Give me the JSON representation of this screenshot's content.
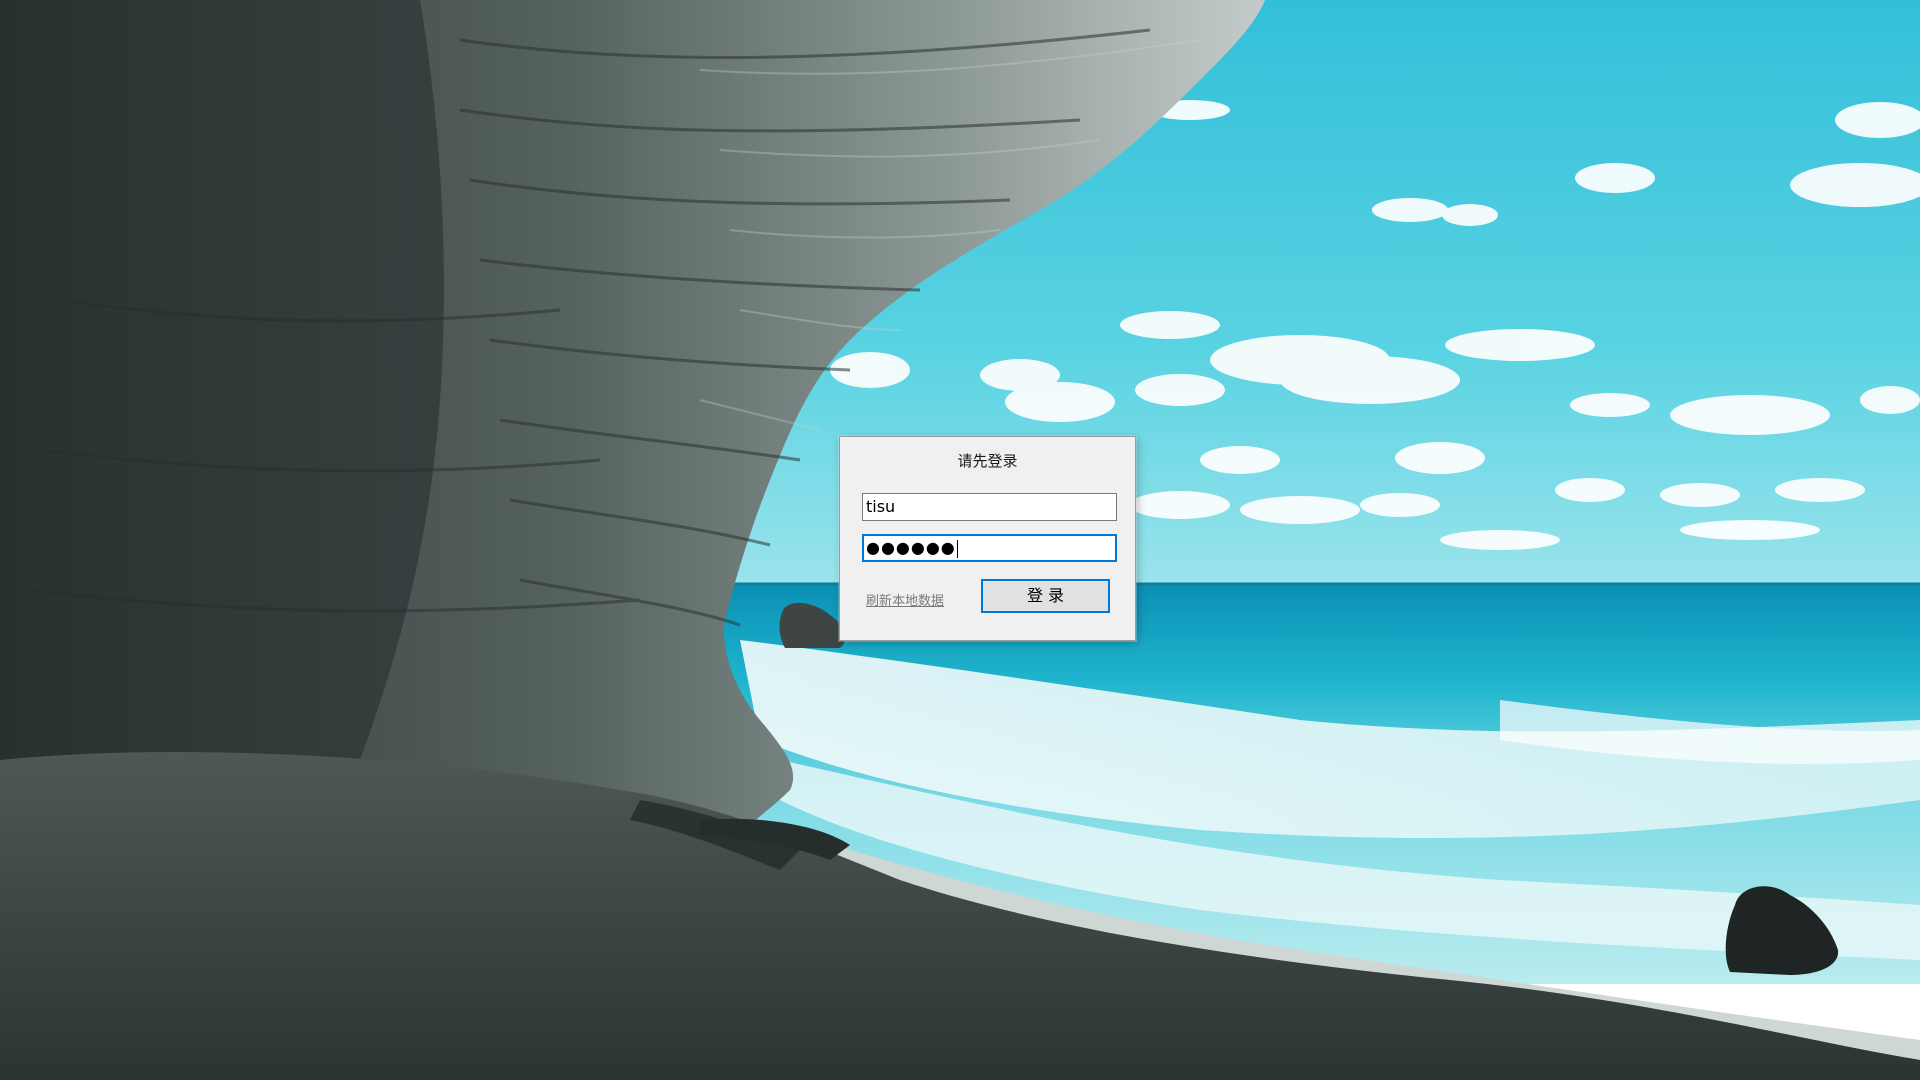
{
  "background": {
    "description_icon": "beach-cave-wallpaper",
    "sky_color": "#3fc6dc",
    "sea_color": "#27b3cf",
    "rock_color": "#4f5856"
  },
  "login_dialog": {
    "title": "请先登录",
    "username_value": "tisu",
    "password_value": "●●●●●●",
    "refresh_link_label": "刷新本地数据",
    "login_button_label": "登 录",
    "accent_color": "#0078d7"
  }
}
